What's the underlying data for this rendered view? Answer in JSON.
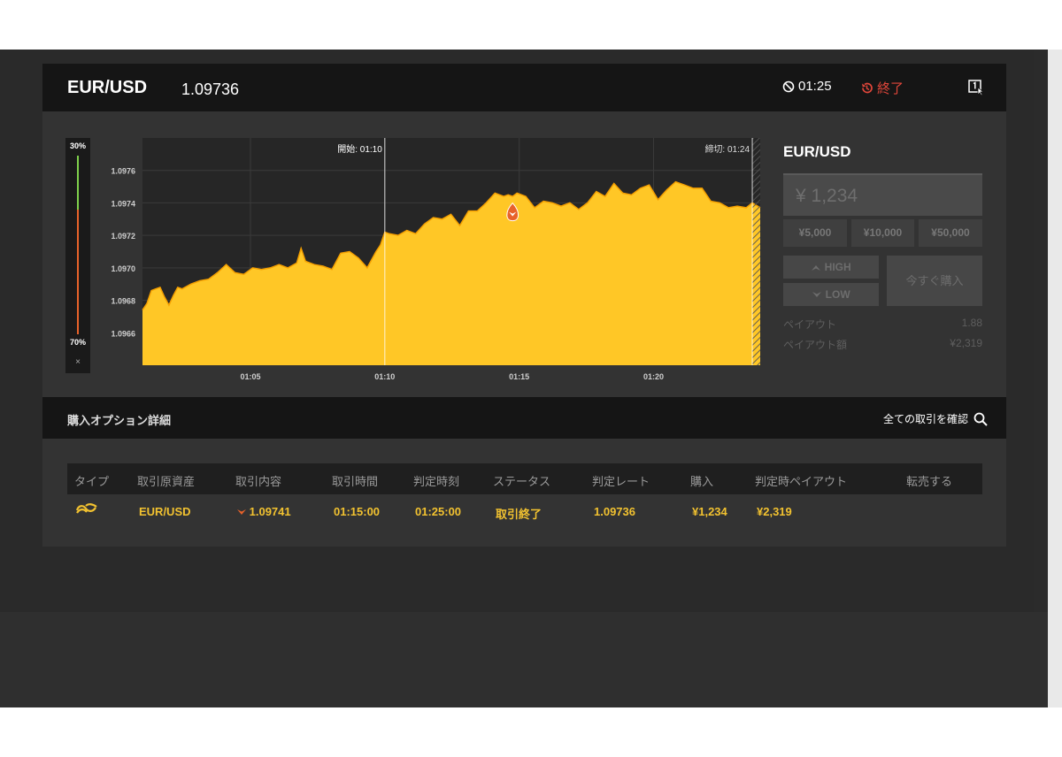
{
  "header": {
    "pair": "EUR/USD",
    "rate": "1.09736",
    "timer": "01:25",
    "status": "終了"
  },
  "probability": {
    "top": "30%",
    "bottom": "70%",
    "close": "×",
    "high_pct": 30,
    "low_pct": 70
  },
  "chart_data": {
    "type": "area",
    "start_label": "開始: 01:10",
    "end_label": "締切: 01:24",
    "x_ticks": [
      "01:05",
      "01:10",
      "01:15",
      "01:20"
    ],
    "y_ticks": [
      "1.0976",
      "1.0974",
      "1.0972",
      "1.0970",
      "1.0968",
      "1.0966"
    ],
    "ylim": [
      1.0964,
      1.0978
    ],
    "xlim": [
      60,
      1462
    ],
    "start_time": 610,
    "end_time": 1444,
    "grid": true,
    "marker": {
      "x": 900,
      "y": 1.09741
    },
    "x": [
      60,
      70,
      80,
      90,
      100,
      110,
      120,
      130,
      140,
      150,
      170,
      190,
      210,
      230,
      250,
      270,
      290,
      310,
      330,
      350,
      370,
      390,
      410,
      420,
      430,
      450,
      470,
      490,
      510,
      530,
      550,
      570,
      590,
      600,
      610,
      620,
      640,
      660,
      680,
      700,
      720,
      740,
      760,
      780,
      800,
      820,
      840,
      860,
      880,
      890,
      900,
      910,
      930,
      950,
      970,
      990,
      1010,
      1030,
      1050,
      1070,
      1090,
      1110,
      1130,
      1150,
      1170,
      1190,
      1210,
      1230,
      1250,
      1270,
      1290,
      1310,
      1330,
      1350,
      1370,
      1390,
      1410,
      1430,
      1444,
      1462
    ],
    "y": [
      1.09674,
      1.09678,
      1.09686,
      1.09687,
      1.09688,
      1.09682,
      1.09677,
      1.09683,
      1.09688,
      1.09687,
      1.0969,
      1.09692,
      1.09693,
      1.09697,
      1.09702,
      1.09697,
      1.09696,
      1.097,
      1.09699,
      1.097,
      1.09702,
      1.097,
      1.09703,
      1.09712,
      1.09704,
      1.09702,
      1.09701,
      1.09699,
      1.09709,
      1.0971,
      1.09706,
      1.097,
      1.0971,
      1.09714,
      1.09722,
      1.09721,
      1.0972,
      1.09723,
      1.09721,
      1.09727,
      1.09731,
      1.0973,
      1.09733,
      1.09726,
      1.09735,
      1.09735,
      1.0974,
      1.09746,
      1.09744,
      1.09745,
      1.09744,
      1.09746,
      1.09744,
      1.09737,
      1.09741,
      1.0974,
      1.09738,
      1.0974,
      1.09736,
      1.0974,
      1.09747,
      1.09744,
      1.09752,
      1.09746,
      1.09745,
      1.09749,
      1.09751,
      1.09742,
      1.09748,
      1.09753,
      1.09751,
      1.09749,
      1.09749,
      1.09741,
      1.0974,
      1.09737,
      1.09738,
      1.09737,
      1.0974,
      1.09737
    ]
  },
  "side": {
    "title": "EUR/USD",
    "amount": "¥ 1,234",
    "presets": [
      "¥5,000",
      "¥10,000",
      "¥50,000"
    ],
    "high": "HIGH",
    "low": "LOW",
    "buy": "今すぐ購入",
    "payout_label": "ペイアウト",
    "payout_value": "1.88",
    "payout_amount_label": "ペイアウト額",
    "payout_amount_value": "¥2,319"
  },
  "options": {
    "title": "購入オプション詳細",
    "link": "全ての取引を確認",
    "columns": [
      "タイプ",
      "取引原資産",
      "取引内容",
      "取引時間",
      "判定時刻",
      "ステータス",
      "判定レート",
      "購入",
      "判定時ペイアウト",
      "転売する"
    ],
    "row": {
      "asset": "EUR/USD",
      "content": "1.09741",
      "trade_time": "01:15:00",
      "judge_time": "01:25:00",
      "status": "取引終了",
      "judge_rate": "1.09736",
      "purchase": "¥1,234",
      "payout": "¥2,319"
    }
  },
  "colors": {
    "accent": "#f2c230",
    "down": "#e8622a",
    "up": "#7ed04b",
    "area": "#ffc726"
  }
}
